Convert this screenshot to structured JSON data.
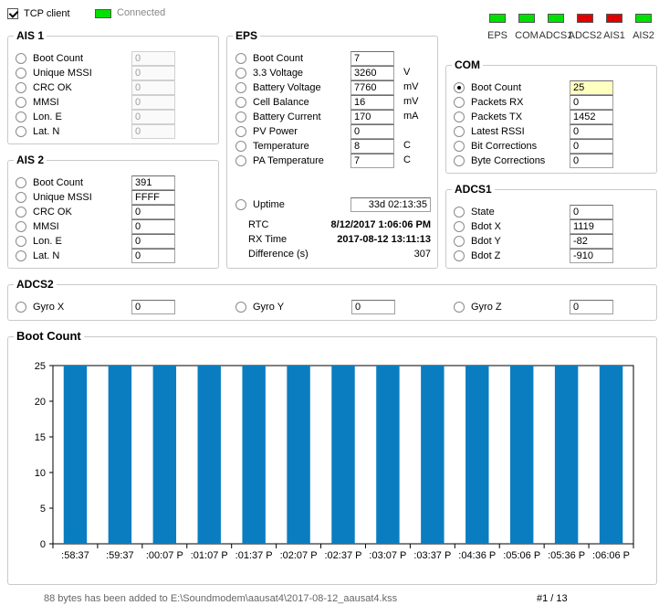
{
  "top": {
    "tcp_label": "TCP client",
    "tcp_checked": true,
    "connected_label": "Connected",
    "connected_color": "#00e000"
  },
  "leds": [
    {
      "label": "EPS",
      "color": "#00e000"
    },
    {
      "label": "COM",
      "color": "#00e000"
    },
    {
      "label": "ADCS1",
      "color": "#00e000"
    },
    {
      "label": "ADCS2",
      "color": "#e00000"
    },
    {
      "label": "AIS1",
      "color": "#e00000"
    },
    {
      "label": "AIS2",
      "color": "#00e000"
    }
  ],
  "ais1": {
    "title": "AIS 1",
    "rows": [
      {
        "label": "Boot Count",
        "value": "0"
      },
      {
        "label": "Unique MSSI",
        "value": "0"
      },
      {
        "label": "CRC OK",
        "value": "0"
      },
      {
        "label": "MMSI",
        "value": "0"
      },
      {
        "label": "Lon. E",
        "value": "0"
      },
      {
        "label": "Lat. N",
        "value": "0"
      }
    ]
  },
  "ais2": {
    "title": "AIS 2",
    "rows": [
      {
        "label": "Boot Count",
        "value": "391"
      },
      {
        "label": "Unique MSSI",
        "value": "FFFF"
      },
      {
        "label": "CRC OK",
        "value": "0"
      },
      {
        "label": "MMSI",
        "value": "0"
      },
      {
        "label": "Lon. E",
        "value": "0"
      },
      {
        "label": "Lat. N",
        "value": "0"
      }
    ]
  },
  "eps": {
    "title": "EPS",
    "rows": [
      {
        "label": "Boot Count",
        "value": "7",
        "unit": ""
      },
      {
        "label": "3.3 Voltage",
        "value": "3260",
        "unit": "V"
      },
      {
        "label": "Battery Voltage",
        "value": "7760",
        "unit": "mV"
      },
      {
        "label": "Cell Balance",
        "value": "16",
        "unit": "mV"
      },
      {
        "label": "Battery Current",
        "value": "170",
        "unit": "mA"
      },
      {
        "label": "PV Power",
        "value": "0",
        "unit": ""
      },
      {
        "label": "Temperature",
        "value": "8",
        "unit": "C"
      },
      {
        "label": "PA Temperature",
        "value": "7",
        "unit": "C"
      }
    ],
    "uptime_label": "Uptime",
    "uptime_value": "33d 02:13:35",
    "rtc_label": "RTC",
    "rtc_value": "8/12/2017 1:06:06 PM",
    "rx_label": "RX Time",
    "rx_value": "2017-08-12 13:11:13",
    "diff_label": "Difference (s)",
    "diff_value": "307"
  },
  "com": {
    "title": "COM",
    "rows": [
      {
        "label": "Boot Count",
        "value": "25",
        "selected": true
      },
      {
        "label": "Packets RX",
        "value": "0",
        "selected": false
      },
      {
        "label": "Packets TX",
        "value": "1452",
        "selected": false
      },
      {
        "label": "Latest RSSI",
        "value": "0",
        "selected": false
      },
      {
        "label": "Bit Corrections",
        "value": "0",
        "selected": false
      },
      {
        "label": "Byte Corrections",
        "value": "0",
        "selected": false
      }
    ]
  },
  "adcs1": {
    "title": "ADCS1",
    "rows": [
      {
        "label": "State",
        "value": "0"
      },
      {
        "label": "Bdot X",
        "value": "1119"
      },
      {
        "label": "Bdot Y",
        "value": "-82"
      },
      {
        "label": "Bdot Z",
        "value": "-910"
      }
    ]
  },
  "adcs2": {
    "title": "ADCS2",
    "rows": [
      {
        "label": "Gyro X",
        "value": "0"
      },
      {
        "label": "Gyro Y",
        "value": "0"
      },
      {
        "label": "Gyro Z",
        "value": "0"
      }
    ]
  },
  "chart_panel": {
    "title": "Boot Count"
  },
  "chart_data": {
    "type": "bar",
    "title": "Boot Count",
    "categories": [
      ":58:37",
      ":59:37",
      ":00:07 P",
      ":01:07 P",
      ":01:37 P",
      ":02:07 P",
      ":02:37 P",
      ":03:07 P",
      ":03:37 P",
      ":04:36 P",
      ":05:06 P",
      ":05:36 P",
      ":06:06 P"
    ],
    "values": [
      25,
      25,
      25,
      25,
      25,
      25,
      25,
      25,
      25,
      25,
      25,
      25,
      25
    ],
    "yticks": [
      "0",
      "5",
      "10",
      "15",
      "20",
      "25"
    ],
    "ylim": [
      0,
      25
    ],
    "bar_color": "#0a7dc0",
    "xlabel": "",
    "ylabel": ""
  },
  "status_bar": {
    "message": "88 bytes has been added to E:\\Soundmodem\\aausat4\\2017-08-12_aausat4.kss",
    "page": "#1 / 13"
  }
}
